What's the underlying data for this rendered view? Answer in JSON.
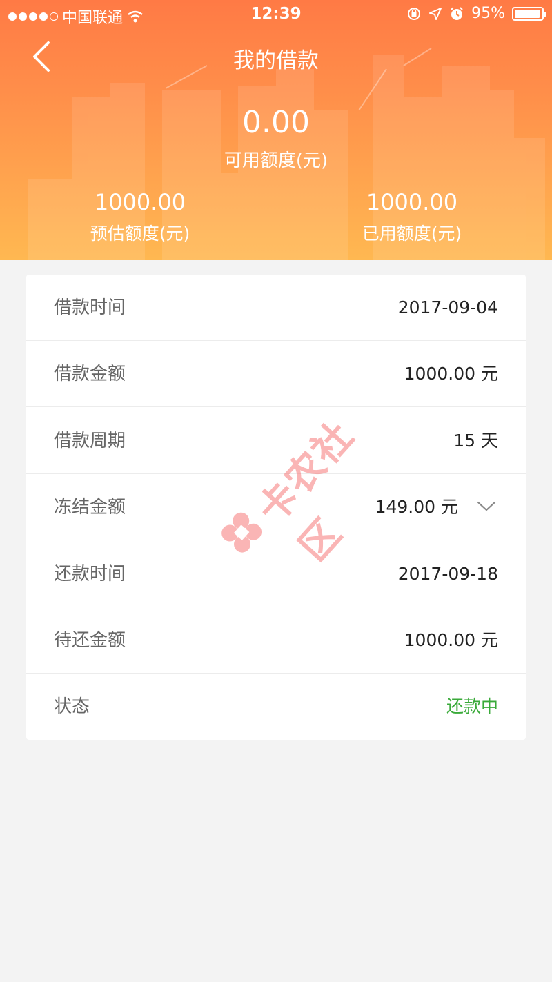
{
  "status_bar": {
    "carrier": "中国联通",
    "time": "12:39",
    "battery": "95%",
    "battery_level": 0.95,
    "icons": [
      "signal-dots-icon",
      "wifi-icon",
      "rotation-lock-icon",
      "location-icon",
      "alarm-icon",
      "battery-icon"
    ]
  },
  "header": {
    "back_icon": "chevron-left-icon",
    "title": "我的借款",
    "available_amount": "0.00",
    "available_label": "可用额度(元)",
    "estimated_amount": "1000.00",
    "estimated_label": "预估额度(元)",
    "used_amount": "1000.00",
    "used_label": "已用额度(元)"
  },
  "details": {
    "rows": [
      {
        "label": "借款时间",
        "value": "2017-09-04"
      },
      {
        "label": "借款金额",
        "value": "1000.00 元"
      },
      {
        "label": "借款周期",
        "value": "15 天"
      },
      {
        "label": "冻结金额",
        "value": "149.00 元"
      },
      {
        "label": "还款时间",
        "value": "2017-09-18"
      },
      {
        "label": "待还金额",
        "value": "1000.00 元"
      },
      {
        "label": "状态",
        "value": "还款中"
      }
    ],
    "expand_icon": "chevron-down-icon",
    "status_color": "#3aaa3a"
  },
  "watermark": {
    "text": "卡农社区",
    "logo_icon": "kanong-logo-icon"
  },
  "colors": {
    "header_top": "#ff7a45",
    "header_bottom": "#ffb851",
    "background": "#f3f3f3"
  }
}
